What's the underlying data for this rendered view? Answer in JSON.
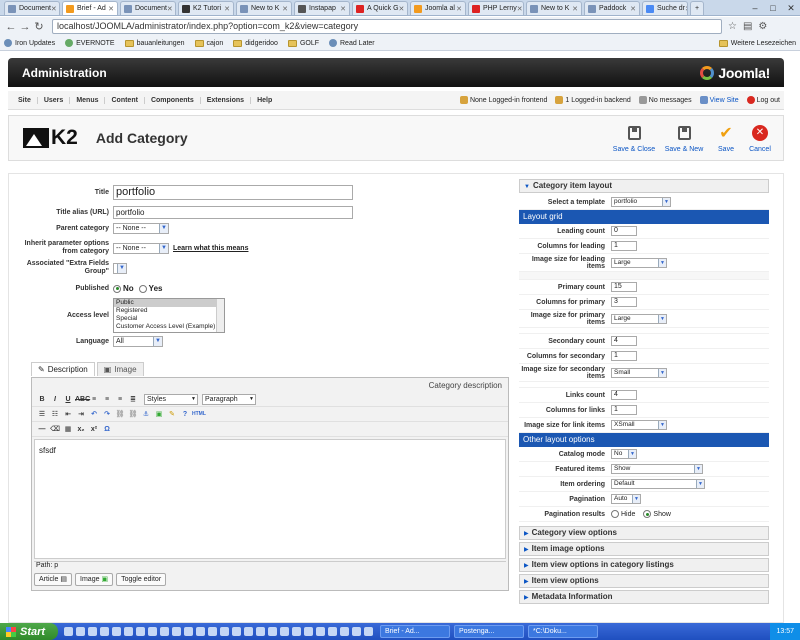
{
  "browser": {
    "tabs": [
      {
        "label": "Document"
      },
      {
        "label": "Brief - Ad"
      },
      {
        "label": "Document"
      },
      {
        "label": "K2 Tutori"
      },
      {
        "label": "New to K"
      },
      {
        "label": "Instapap"
      },
      {
        "label": "A Quick G"
      },
      {
        "label": "Joomla al"
      },
      {
        "label": "PHP Lerny"
      },
      {
        "label": "New to K"
      },
      {
        "label": "Paddock"
      },
      {
        "label": "Suche dr"
      }
    ],
    "url": "localhost/JOOMLA/administrator/index.php?option=com_k2&view=category",
    "bookmarks": [
      "Iron Updates",
      "EVERNOTE",
      "bauanleitungen",
      "cajon",
      "didgeridoo",
      "GOLF",
      "Read Later"
    ],
    "other_bookmarks": "Weitere Lesezeichen"
  },
  "admin": {
    "title": "Administration",
    "brand": "Joomla!",
    "menu": [
      "Site",
      "Users",
      "Menus",
      "Content",
      "Components",
      "Extensions",
      "Help"
    ],
    "status": {
      "frontend": "None Logged-in frontend",
      "backend": "1 Logged-in backend",
      "messages": "No messages",
      "view_site": "View Site",
      "logout": "Log out"
    }
  },
  "toolbar": {
    "logo": "K2",
    "page_title": "Add Category",
    "save_close": "Save & Close",
    "save_new": "Save & New",
    "save": "Save",
    "cancel": "Cancel"
  },
  "form": {
    "title_label": "Title",
    "title_value": "portfolio",
    "alias_label": "Title alias (URL)",
    "alias_value": "portfolio",
    "parent_label": "Parent category",
    "parent_value": "-- None --",
    "inherit_label": "Inherit parameter options from category",
    "inherit_value": "-- None --",
    "inherit_link": "Learn what this means",
    "extra_label": "Associated \"Extra Fields Group\"",
    "published_label": "Published",
    "published_no": "No",
    "published_yes": "Yes",
    "access_label": "Access level",
    "access_options": [
      "Public",
      "Registered",
      "Special",
      "Customer Access Level (Example)"
    ],
    "language_label": "Language",
    "language_value": "All"
  },
  "editor": {
    "tab_description": "Description",
    "tab_image": "Image",
    "heading": "Category description",
    "styles": "Styles",
    "paragraph": "Paragraph",
    "content": "sfsdf",
    "path": "Path: p",
    "btn_article": "Article",
    "btn_image": "Image",
    "btn_toggle": "Toggle editor"
  },
  "panel": {
    "layout_head": "Category item layout",
    "template_label": "Select a template",
    "template_value": "portfolio",
    "layout_grid": "Layout grid",
    "leading_count_label": "Leading count",
    "leading_count": "0",
    "columns_leading_label": "Columns for leading",
    "columns_leading": "1",
    "image_leading_label": "Image size for leading items",
    "image_leading": "Large",
    "primary_count_label": "Primary count",
    "primary_count": "15",
    "columns_primary_label": "Columns for primary",
    "columns_primary": "3",
    "image_primary_label": "Image size for primary items",
    "image_primary": "Large",
    "secondary_count_label": "Secondary count",
    "secondary_count": "4",
    "columns_secondary_label": "Columns for secondary",
    "columns_secondary": "1",
    "image_secondary_label": "Image size for secondary items",
    "image_secondary": "Small",
    "links_count_label": "Links count",
    "links_count": "4",
    "columns_links_label": "Columns for links",
    "columns_links": "1",
    "image_links_label": "Image size for link items",
    "image_links": "XSmall",
    "other_layout": "Other layout options",
    "catalog_mode_label": "Catalog mode",
    "catalog_mode": "No",
    "featured_label": "Featured items",
    "featured": "Show",
    "ordering_label": "Item ordering",
    "ordering": "Default",
    "pagination_label": "Pagination",
    "pagination": "Auto",
    "pag_results_label": "Pagination results",
    "pag_hide": "Hide",
    "pag_show": "Show",
    "collapsed": [
      "Category view options",
      "Item image options",
      "Item view options in category listings",
      "Item view options",
      "Metadata Information"
    ]
  },
  "taskbar": {
    "start": "Start",
    "items": [
      "Brief - Ad...",
      "Postenga...",
      "*C:\\Doku..."
    ],
    "clock": "13:57"
  }
}
